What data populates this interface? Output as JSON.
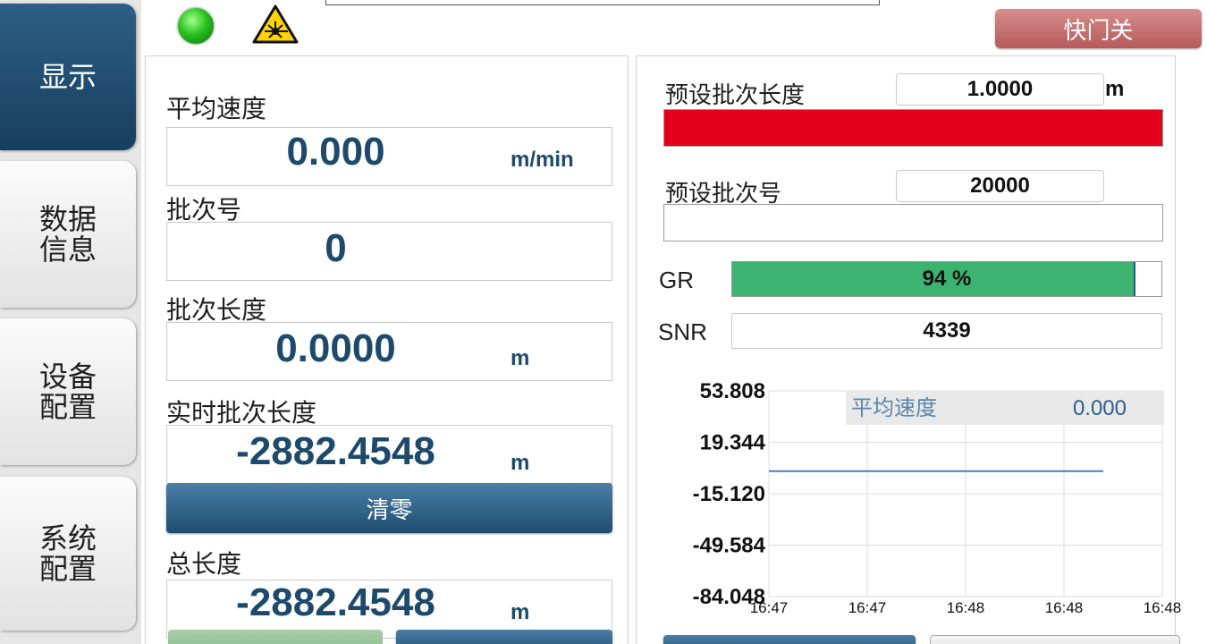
{
  "nav": {
    "items": [
      {
        "label": "显示",
        "active": true
      },
      {
        "label": "数据\n信息",
        "active": false
      },
      {
        "label": "设备\n配置",
        "active": false
      },
      {
        "label": "系统\n配置",
        "active": false
      }
    ]
  },
  "top": {
    "status_led_color": "#27c21f",
    "laser_icon": "laser-warning-icon",
    "shutter_label": "快门关"
  },
  "left": {
    "avg_speed": {
      "label": "平均速度",
      "value": "0.000",
      "unit": "m/min"
    },
    "batch_no": {
      "label": "批次号",
      "value": "0"
    },
    "batch_len": {
      "label": "批次长度",
      "value": "0.0000",
      "unit": "m"
    },
    "realtime_len": {
      "label": "实时批次长度",
      "value": "-2882.4548",
      "unit": "m"
    },
    "clear_label": "清零",
    "total_len": {
      "label": "总长度",
      "value": "-2882.4548",
      "unit": "m"
    }
  },
  "right": {
    "preset_len": {
      "label": "预设批次长度",
      "value": "1.0000",
      "unit": "m",
      "bar_color": "#e3001b"
    },
    "preset_no": {
      "label": "预设批次号",
      "value": "20000"
    },
    "gr": {
      "label": "GR",
      "percent": 94,
      "text": "94 %"
    },
    "snr": {
      "label": "SNR",
      "value": "4339"
    }
  },
  "chart_data": {
    "type": "line",
    "series": [
      {
        "name": "平均速度",
        "value_label": "0.000",
        "x": [
          "16:47",
          "16:47",
          "16:48",
          "16:48",
          "16:48"
        ],
        "y": [
          0.0,
          0.0,
          0.0,
          0.0,
          0.0
        ]
      }
    ],
    "x_ticks": [
      "16:47",
      "16:47",
      "16:48",
      "16:48",
      "16:48"
    ],
    "y_ticks": [
      "53.808",
      "19.344",
      "-15.120",
      "-49.584",
      "-84.048"
    ],
    "ylim": [
      -84.048,
      53.808
    ],
    "grid": true,
    "legend": "top",
    "line_color": "#4a7fb5"
  }
}
